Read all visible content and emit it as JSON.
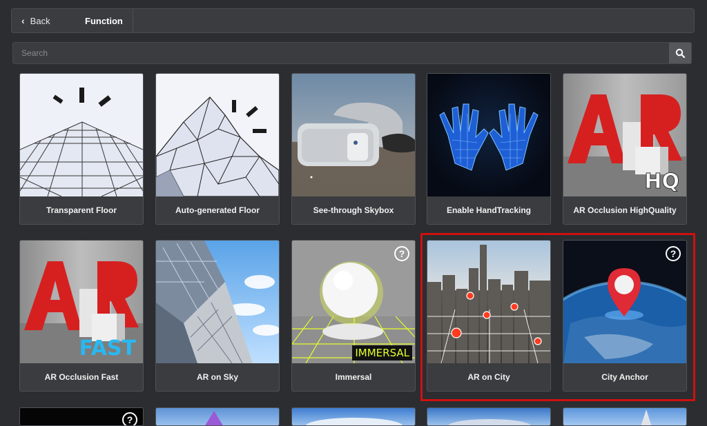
{
  "header": {
    "back_label": "Back",
    "tab_label": "Function"
  },
  "search": {
    "placeholder": "Search"
  },
  "cards": [
    {
      "label": "Transparent Floor",
      "icon": "transparent-floor-grid-icon"
    },
    {
      "label": "Auto-generated Floor",
      "icon": "mesh-terrain-icon"
    },
    {
      "label": "See-through Skybox",
      "icon": "vr-headset-icon"
    },
    {
      "label": "Enable HandTracking",
      "icon": "wireframe-hands-icon"
    },
    {
      "label": "AR Occlusion HighQuality",
      "icon": "ar-occlusion-icon",
      "badge": "HQ"
    },
    {
      "label": "AR Occlusion Fast",
      "icon": "ar-occlusion-icon",
      "badge": "FAST"
    },
    {
      "label": "AR on Sky",
      "icon": "sky-buildings-icon"
    },
    {
      "label": "Immersal",
      "icon": "sphere-grid-icon",
      "badge": "IMMERSAL",
      "help": "?"
    },
    {
      "label": "AR on City",
      "icon": "city-map-pins-icon"
    },
    {
      "label": "City Anchor",
      "icon": "globe-pin-icon",
      "help": "?"
    }
  ],
  "next_row_help": "?",
  "colors": {
    "highlight": "#d01010",
    "ar_red": "#d62020",
    "fast_blue": "#2ab8f0",
    "hq_white": "#ffffff"
  }
}
